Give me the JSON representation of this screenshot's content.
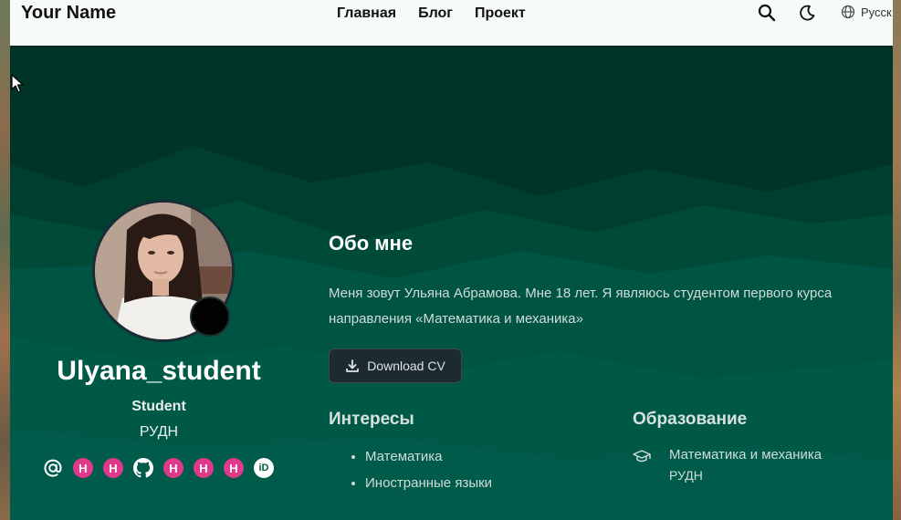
{
  "header": {
    "brand": "Your Name",
    "nav": [
      "Главная",
      "Блог",
      "Проект"
    ],
    "search_icon": "search-icon",
    "theme_icon": "moon-icon",
    "language": "Русск"
  },
  "profile": {
    "name": "Ulyana_student",
    "role": "Student",
    "organization": "РУДН",
    "social_icons": [
      "at-icon",
      "hugo-icon",
      "hugo-icon",
      "github-icon",
      "hugo-icon",
      "hugo-icon",
      "hugo-icon",
      "orcid-icon"
    ],
    "social_labels": {
      "hugo": "H",
      "orcid": "iD"
    }
  },
  "about": {
    "title": "Обо мне",
    "line1": "Меня зовут Ульяна Абрамова. Мне 18 лет. Я являюсь студентом первого курса",
    "line2": "направления «Математика и механика»",
    "download_cv": "Download CV"
  },
  "interests": {
    "title": "Интересы",
    "items": [
      "Математика",
      "Иностранные языки"
    ]
  },
  "education": {
    "title": "Образование",
    "course": "Математика и механика",
    "institution": "РУДН"
  },
  "colors": {
    "hero_dark": "#003b2b",
    "hero_mid": "#005a46",
    "accent_hugo": "#e0388a",
    "header_bg": "#f6fbf8"
  }
}
